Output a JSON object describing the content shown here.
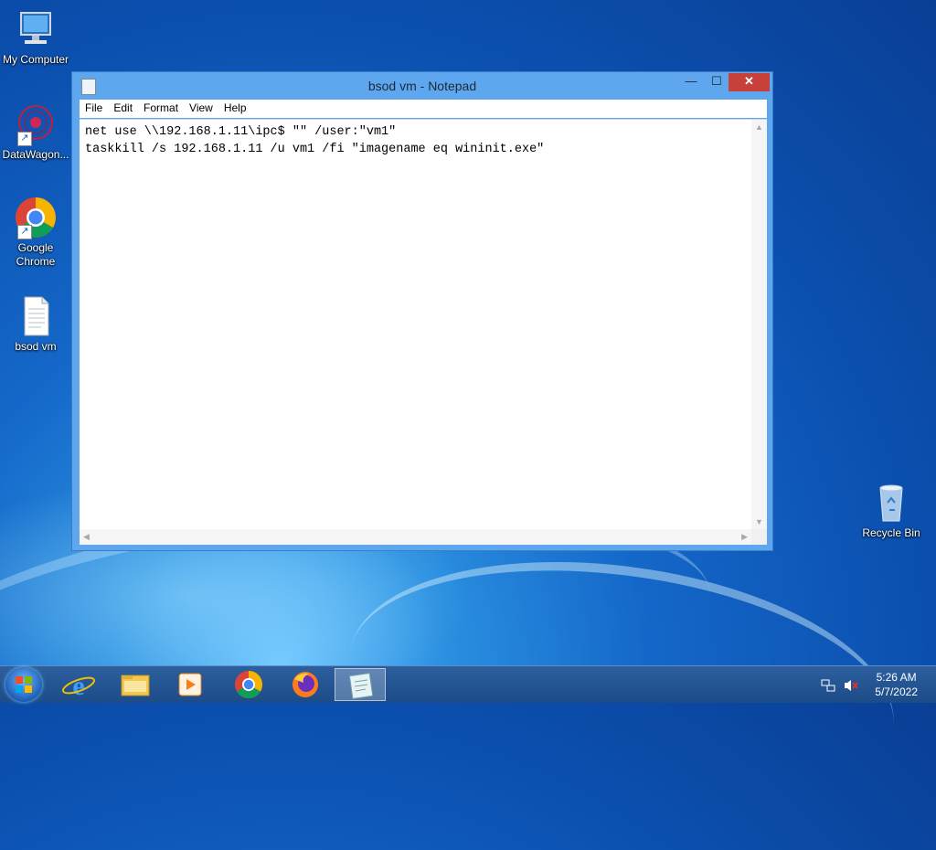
{
  "desktop": {
    "icons": [
      {
        "label": "My Computer"
      },
      {
        "label": "DataWagon..."
      },
      {
        "label": "Google Chrome"
      },
      {
        "label": "bsod vm"
      },
      {
        "label": "Recycle Bin"
      }
    ]
  },
  "window": {
    "title": "bsod vm - Notepad",
    "controls": {
      "minimize": "—",
      "maximize": "☐",
      "close": "✕"
    },
    "menu": [
      "File",
      "Edit",
      "Format",
      "View",
      "Help"
    ],
    "lines": [
      "net use \\\\192.168.1.11\\ipc$ \"\" /user:\"vm1\"",
      "taskkill /s 192.168.1.11 /u vm1 /fi \"imagename eq wininit.exe\""
    ]
  },
  "taskbar": {
    "apps": [
      "internet-explorer-icon",
      "file-explorer-icon",
      "media-player-icon",
      "chrome-icon",
      "firefox-icon",
      "notepad-icon"
    ],
    "clock": {
      "time": "5:26 AM",
      "date": "5/7/2022"
    }
  }
}
